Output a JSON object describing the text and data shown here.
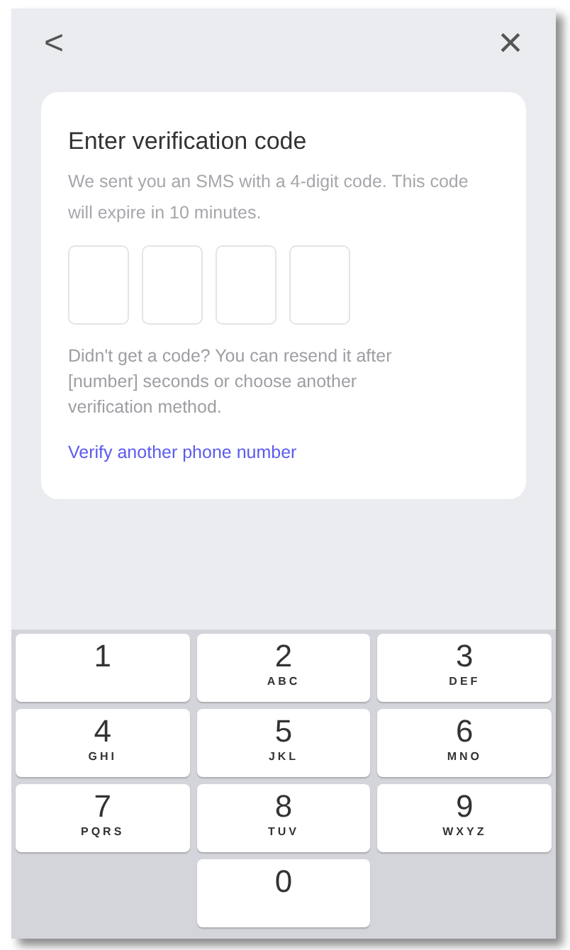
{
  "header": {
    "back": "<",
    "close": "×"
  },
  "card": {
    "title": "Enter verification code",
    "description": "We sent you an SMS with a 4-digit code. This code will expire in 10 minutes.",
    "code_boxes": [
      {
        "selected": false
      },
      {
        "selected": false
      },
      {
        "selected": false
      },
      {
        "selected": false
      }
    ],
    "help": "Didn't get a code? You can resend it after [number] seconds or choose another verification method.",
    "link": "Verify another phone number"
  },
  "keypad": {
    "rows": [
      [
        {
          "digit": "1"
        },
        {
          "digit": "2",
          "letters": "ABC"
        },
        {
          "digit": "3",
          "letters": "DEF"
        }
      ],
      [
        {
          "digit": "4",
          "letters": "GHI"
        },
        {
          "digit": "5",
          "letters": "JKL"
        },
        {
          "digit": "6",
          "letters": "MNO"
        }
      ],
      [
        {
          "digit": "7",
          "letters": "PQRS"
        },
        {
          "digit": "8",
          "letters": "TUV"
        },
        {
          "digit": "9",
          "letters": "WXYZ"
        }
      ],
      [
        "",
        {
          "digit": "0"
        },
        ""
      ]
    ]
  }
}
